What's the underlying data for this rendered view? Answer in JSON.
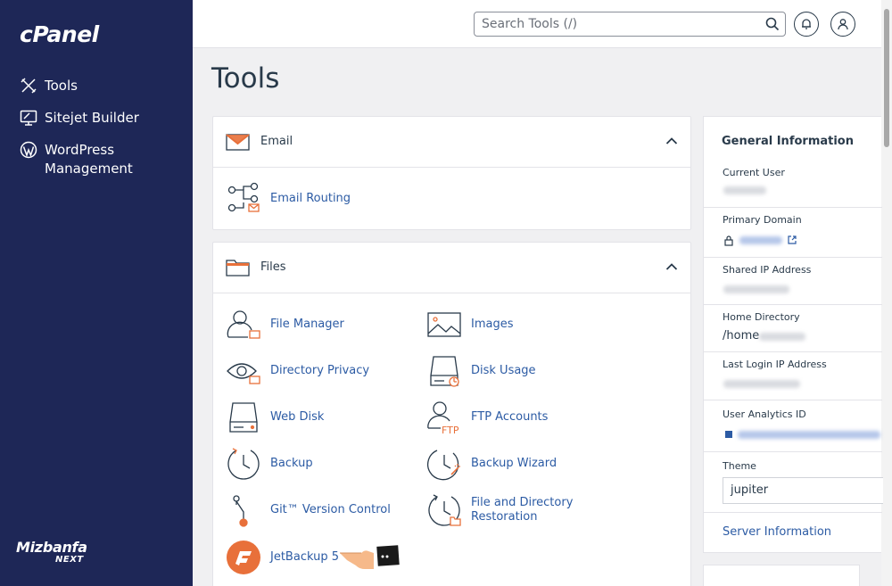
{
  "sidebar": {
    "logo": "cPanel",
    "items": [
      {
        "label": "Tools"
      },
      {
        "label": "Sitejet Builder"
      },
      {
        "label_line1": "WordPress",
        "label_line2": "Management"
      }
    ],
    "watermark_line1": "Mizbanfa",
    "watermark_line2": "NEXT"
  },
  "header": {
    "search_placeholder": "Search Tools (/)",
    "icons": [
      "search-icon",
      "bell-icon",
      "user-icon"
    ]
  },
  "page_title": "Tools",
  "sections": {
    "email": {
      "title": "Email",
      "tools": [
        "Email Routing"
      ]
    },
    "files": {
      "title": "Files",
      "tools": [
        "File Manager",
        "Images",
        "Directory Privacy",
        "Disk Usage",
        "Web Disk",
        "FTP Accounts",
        "Backup",
        "Backup Wizard",
        "Git™ Version Control",
        "File and Directory Restoration",
        "JetBackup 5"
      ],
      "tool_restore_line1": "File and Directory",
      "tool_restore_line2": "Restoration"
    }
  },
  "general_info": {
    "title": "General Information",
    "current_user_label": "Current User",
    "primary_domain_label": "Primary Domain",
    "shared_ip_label": "Shared IP Address",
    "home_directory_label": "Home Directory",
    "home_directory_value": "/home",
    "last_login_ip_label": "Last Login IP Address",
    "user_analytics_label": "User Analytics ID",
    "theme_label": "Theme",
    "theme_value": "jupiter",
    "server_info_link": "Server Information"
  },
  "colors": {
    "sidebar_bg": "#1e2757",
    "link": "#2c5ba4",
    "accent_orange": "#e8703a"
  }
}
